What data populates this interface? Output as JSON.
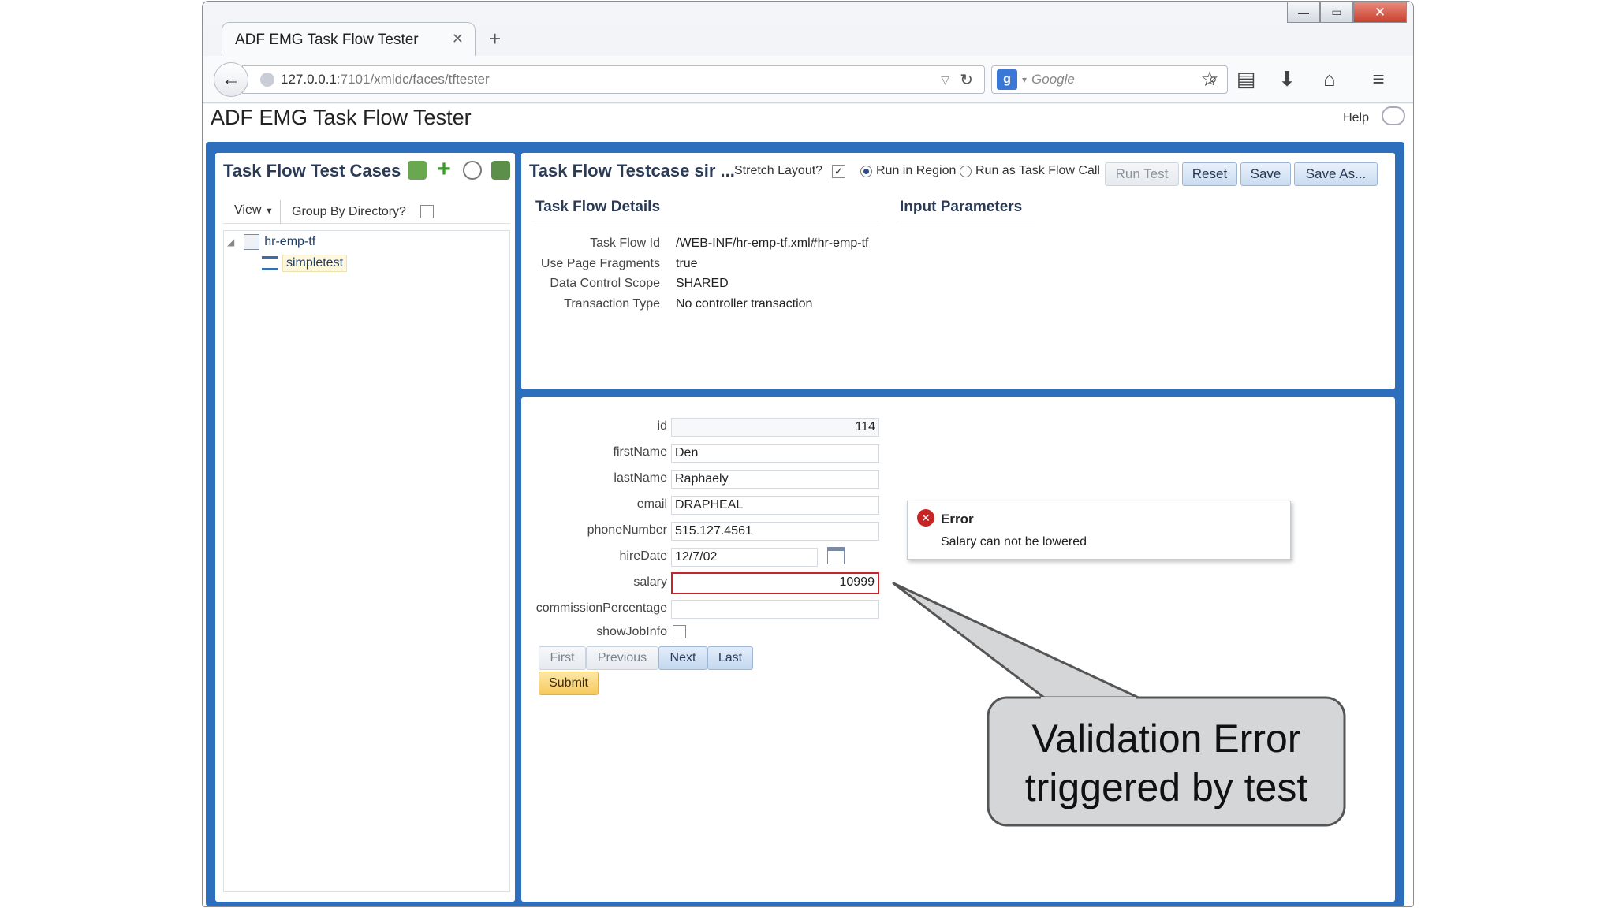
{
  "browser": {
    "tab_title": "ADF EMG Task Flow Tester",
    "tab_close": "✕",
    "new_tab": "+",
    "url_host": "127.0.0.1",
    "url_rest": ":7101/xmldc/faces/tftester",
    "search_placeholder": "Google",
    "window_controls": {
      "minimize": "—",
      "maximize": "▭",
      "close": "✕"
    }
  },
  "app": {
    "title": "ADF EMG Task Flow Tester",
    "help": "Help"
  },
  "left_panel": {
    "title": "Task Flow Test Cases",
    "view_label": "View",
    "group_by_label": "Group By Directory?",
    "tree": [
      {
        "label": "hr-emp-tf",
        "level": 0
      },
      {
        "label": "simpletest",
        "level": 1
      }
    ]
  },
  "top_panel": {
    "title": "Task Flow Testcase sir ...",
    "stretch_label": "Stretch Layout?",
    "run_in_region": "Run in Region",
    "run_as_call": "Run as Task Flow Call",
    "buttons": {
      "run_test": "Run Test",
      "reset": "Reset",
      "save": "Save",
      "save_as": "Save As..."
    },
    "details_heading": "Task Flow Details",
    "params_heading": "Input Parameters",
    "details": [
      {
        "label": "Task Flow Id",
        "value": "/WEB-INF/hr-emp-tf.xml#hr-emp-tf"
      },
      {
        "label": "Use Page Fragments",
        "value": "true"
      },
      {
        "label": "Data Control Scope",
        "value": "SHARED"
      },
      {
        "label": "Transaction Type",
        "value": "No controller transaction"
      }
    ]
  },
  "form": {
    "id_label": "id",
    "id_value": "114",
    "firstName_label": "firstName",
    "firstName_value": "Den",
    "lastName_label": "lastName",
    "lastName_value": "Raphaely",
    "email_label": "email",
    "email_value": "DRAPHEAL",
    "phone_label": "phoneNumber",
    "phone_value": "515.127.4561",
    "hireDate_label": "hireDate",
    "hireDate_value": "12/7/02",
    "salary_label": "salary",
    "salary_value": "10999",
    "commission_label": "commissionPercentage",
    "commission_value": "",
    "showJobInfo_label": "showJobInfo",
    "nav": {
      "first": "First",
      "previous": "Previous",
      "next": "Next",
      "last": "Last"
    },
    "submit": "Submit"
  },
  "error_popup": {
    "title": "Error",
    "message": "Salary can not be lowered"
  },
  "callout": {
    "line1": "Validation Error",
    "line2": "triggered by test"
  },
  "colors": {
    "frame_blue": "#2d6fbc",
    "error_red": "#c3252a",
    "submit_yellow": "#f6c95c"
  }
}
